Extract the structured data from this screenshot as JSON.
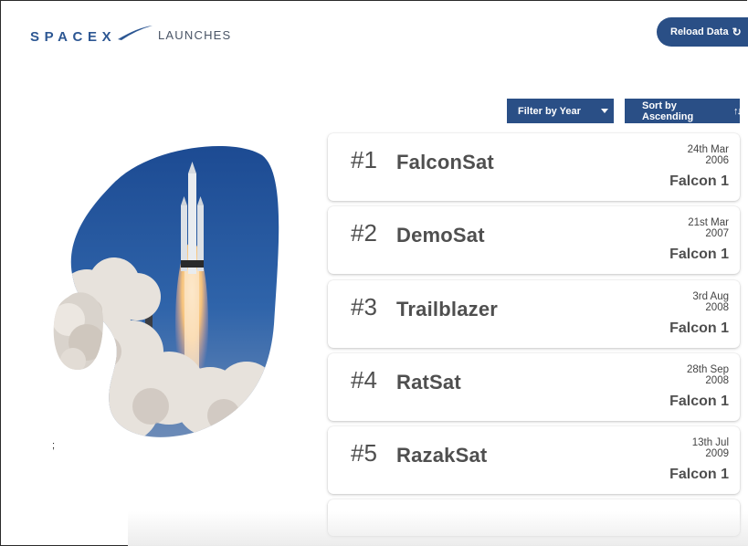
{
  "header": {
    "logo_text": "SPACEX",
    "logo_sub": "LAUNCHES",
    "reload_label": "Reload Data",
    "reload_icon": "refresh-icon"
  },
  "controls": {
    "filter_label": "Filter by Year",
    "sort_label": "Sort by Ascending",
    "sort_icon": "sort-arrows-icon"
  },
  "stray_text": ";",
  "launches": [
    {
      "number": "#1",
      "name": "FalconSat",
      "date_day": "24th Mar",
      "date_year": "2006",
      "rocket": "Falcon 1"
    },
    {
      "number": "#2",
      "name": "DemoSat",
      "date_day": "21st Mar",
      "date_year": "2007",
      "rocket": "Falcon 1"
    },
    {
      "number": "#3",
      "name": "Trailblazer",
      "date_day": "3rd Aug",
      "date_year": "2008",
      "rocket": "Falcon 1"
    },
    {
      "number": "#4",
      "name": "RatSat",
      "date_day": "28th Sep",
      "date_year": "2008",
      "rocket": "Falcon 1"
    },
    {
      "number": "#5",
      "name": "RazakSat",
      "date_day": "13th Jul",
      "date_year": "2009",
      "rocket": "Falcon 1"
    }
  ],
  "colors": {
    "brand_blue": "#2a4f86",
    "sky_blue": "#2b5da8"
  }
}
